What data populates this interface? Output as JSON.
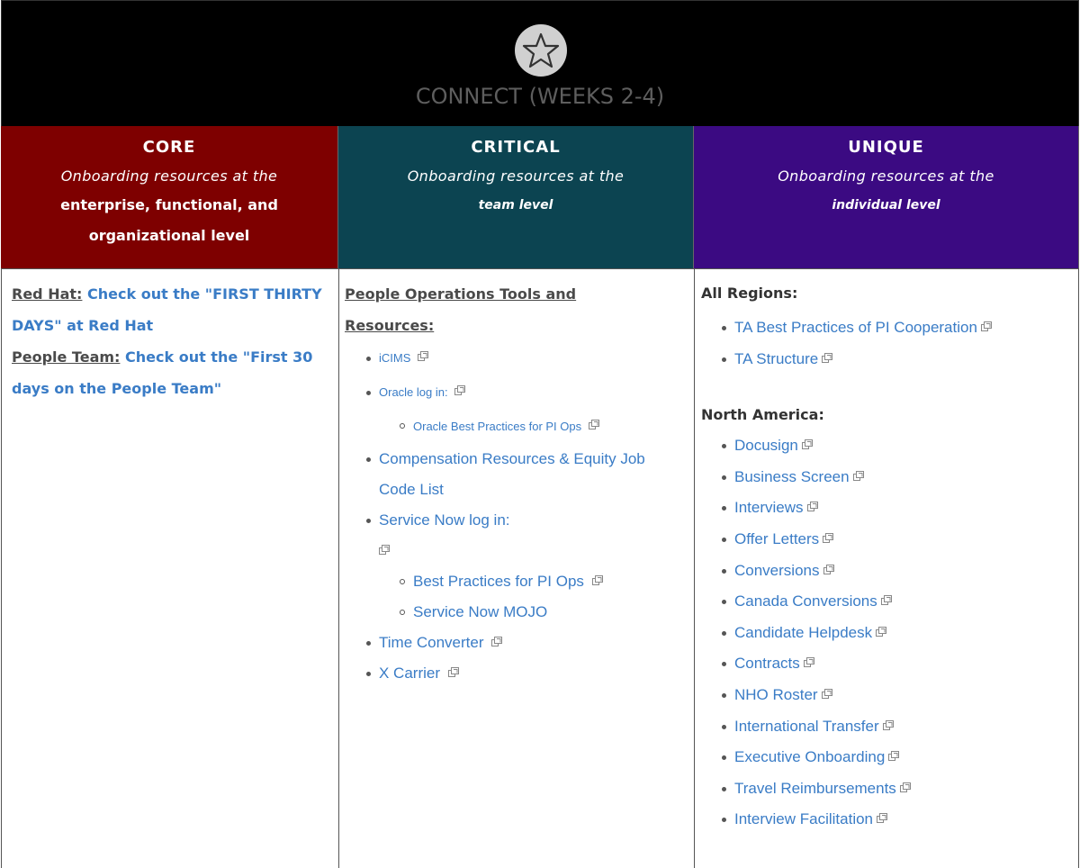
{
  "banner": {
    "title": "CONNECT (WEEKS 2-4)",
    "icon": "star-icon",
    "background": "#000000"
  },
  "columns": {
    "core": {
      "heading": "CORE",
      "subtitle": "Onboarding resources at the",
      "bold_text_1": "enterprise, functional, and",
      "bold_text_2": "organizational level",
      "color": "#7e0000"
    },
    "critical": {
      "heading": "CRITICAL",
      "subtitle": "Onboarding resources at the",
      "bold_italic": "team level",
      "color": "#0c4451"
    },
    "unique": {
      "heading": "UNIQUE",
      "subtitle": "Onboarding resources at the",
      "bold_italic": "individual level",
      "color": "#3b0a82"
    }
  },
  "core_body": {
    "redhat_label": "Red Hat:",
    "redhat_link": "Check out the \"FIRST THIRTY DAYS\" at Red Hat",
    "people_label": "People Team:",
    "people_link": "Check out the \"First 30 days on the People Team\""
  },
  "critical_body": {
    "title": "People Operations Tools and Resources:",
    "icims": "iCIMS",
    "oracle": "Oracle log in:",
    "oracle_best": "Oracle Best Practices for PI Ops",
    "compensation": "Compensation Resources & Equity Job Code List",
    "service_now": "Service Now log in:",
    "best_practices": "Best Practices for PI Ops",
    "mojo": "Service Now MOJO",
    "time_converter": "Time Converter",
    "x_carrier": "X Carrier"
  },
  "unique_body": {
    "all_regions_title": "All Regions:",
    "all_regions": [
      "TA Best Practices of PI Cooperation",
      "TA Structure"
    ],
    "north_america_title": "North America:",
    "north_america": [
      "Docusign",
      "Business Screen",
      "Interviews",
      "Offer Letters",
      "Conversions",
      "Canada Conversions",
      "Candidate Helpdesk",
      "Contracts",
      "NHO Roster",
      "International Transfer",
      "Executive Onboarding",
      "Travel Reimbursements",
      "Interview Facilitation"
    ]
  },
  "link_color": "#3a7cc6"
}
